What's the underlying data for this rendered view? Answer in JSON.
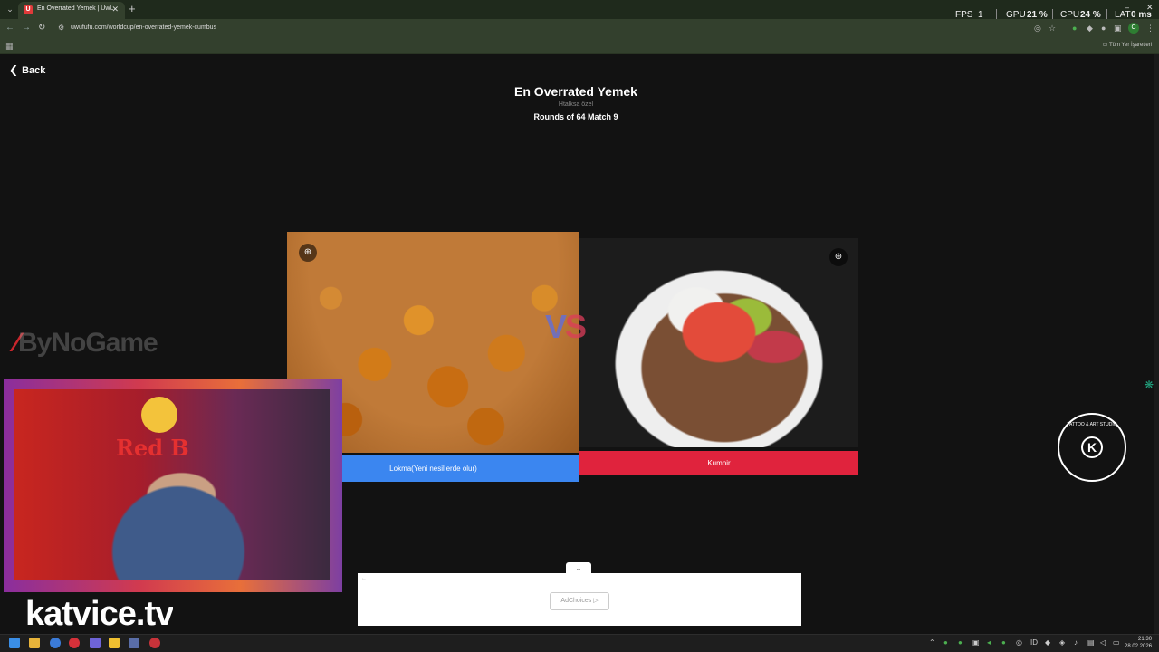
{
  "browser": {
    "tab_title": "En Overrated Yemek | UwUFUFU",
    "tab_favicon": "U",
    "new_tab": "+",
    "url": "uwufufu.com/worldcup/en-overrated-yemek-cumbus",
    "bookmarks_all": "Tüm Yer İşaretleri",
    "profile_initial": "C"
  },
  "perf_overlay": {
    "fps_label": "FPS",
    "fps_value": "1",
    "gpu_label": "GPU",
    "gpu_value": "21 %",
    "cpu_label": "CPU",
    "cpu_value": "24 %",
    "lat_label": "LAT",
    "lat_value": "0 ms"
  },
  "page": {
    "back_label": "Back",
    "title": "En Overrated Yemek",
    "subtitle": "Htalksa özel",
    "round": "Rounds of 64 Match 9",
    "vs_v": "V",
    "vs_s": "S",
    "left_choice": "Lokma(Yeni nesillerde olur)",
    "right_choice": "Kumpir",
    "ad_choices": "AdChoices ▷"
  },
  "overlay": {
    "sponsor": "ByNoGame",
    "redbull_text": "Red B",
    "channel": "katvice.tv",
    "studio_ring": "TATTOO & ART STUDIO",
    "studio_letter": "K"
  },
  "taskbar": {
    "time": "21:30",
    "date": "28.02.2026"
  },
  "colors": {
    "left_button": "#3b86f0",
    "right_button": "#e0233d",
    "page_bg": "#121212",
    "chrome_bg": "#33402d"
  }
}
